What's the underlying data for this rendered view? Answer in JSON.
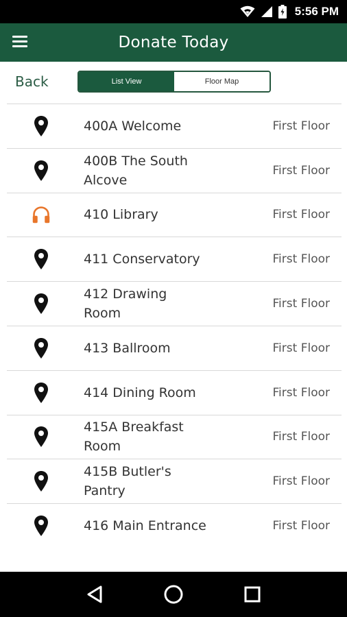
{
  "status_bar": {
    "time": "5:56 PM",
    "icons": [
      "wifi-icon",
      "signal-icon",
      "battery-icon"
    ]
  },
  "app_bar": {
    "title": "Donate Today",
    "menu_icon": "hamburger-menu-icon"
  },
  "toolbar": {
    "back_label": "Back",
    "tabs": [
      {
        "label": "List View",
        "active": true
      },
      {
        "label": "Floor Map",
        "active": false
      }
    ]
  },
  "list": {
    "items": [
      {
        "title": "400A Welcome",
        "floor": "First Floor",
        "icon": "map-pin-icon"
      },
      {
        "title": "400B The South Alcove",
        "floor": "First Floor",
        "icon": "map-pin-icon"
      },
      {
        "title": "410 Library",
        "floor": "First Floor",
        "icon": "headphones-icon"
      },
      {
        "title": "411 Conservatory",
        "floor": "First Floor",
        "icon": "map-pin-icon"
      },
      {
        "title": "412 Drawing Room",
        "floor": "First Floor",
        "icon": "map-pin-icon"
      },
      {
        "title": "413 Ballroom",
        "floor": "First Floor",
        "icon": "map-pin-icon"
      },
      {
        "title": "414 Dining Room",
        "floor": "First Floor",
        "icon": "map-pin-icon"
      },
      {
        "title": "415A Breakfast Room",
        "floor": "First Floor",
        "icon": "map-pin-icon"
      },
      {
        "title": "415B Butler's Pantry",
        "floor": "First Floor",
        "icon": "map-pin-icon"
      },
      {
        "title": "416 Main Entrance",
        "floor": "First Floor",
        "icon": "map-pin-icon"
      }
    ]
  },
  "nav_bar": {
    "buttons": [
      "back-triangle-icon",
      "home-circle-icon",
      "recents-square-icon"
    ]
  },
  "colors": {
    "primary_green": "#1b5a3e",
    "headphones_orange": "#e8762b"
  }
}
